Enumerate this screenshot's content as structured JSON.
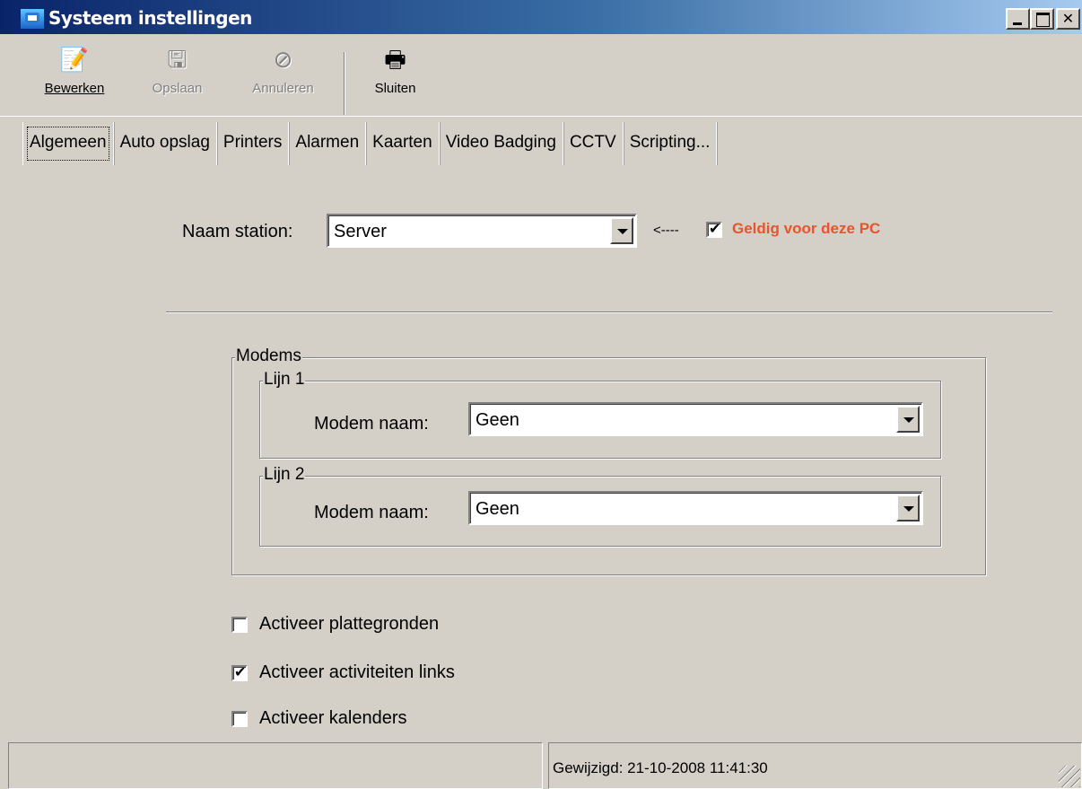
{
  "window": {
    "title": "Systeem instellingen",
    "minimize": "_",
    "maximize": "□",
    "close": "✕"
  },
  "toolbar": {
    "edit": {
      "label": "Bewerken",
      "icon": "edit-document-icon",
      "glyph": "📝"
    },
    "save": {
      "label": "Opslaan",
      "icon": "save-icon",
      "glyph": "🖫"
    },
    "cancel": {
      "label": "Annuleren",
      "icon": "cancel-icon",
      "glyph": "⊘"
    },
    "close": {
      "label": "Sluiten",
      "icon": "close-document-icon",
      "glyph": "🖶"
    }
  },
  "tabs": [
    "Algemeen",
    "Auto opslag",
    "Printers",
    "Alarmen",
    "Kaarten",
    "Video Badging",
    "CCTV",
    "Scripting..."
  ],
  "general": {
    "station_label": "Naam station:",
    "station_value": "Server",
    "arrow_text": "<----",
    "valid_label": "Geldig voor deze PC",
    "valid_checked": true,
    "valid_color": "#e8542c"
  },
  "modems": {
    "legend": "Modems",
    "line1": {
      "legend": "Lijn 1",
      "label": "Modem naam:",
      "value": "Geen"
    },
    "line2": {
      "legend": "Lijn 2",
      "label": "Modem naam:",
      "value": "Geen"
    }
  },
  "options": [
    {
      "label": "Activeer plattegronden",
      "checked": false
    },
    {
      "label": "Activeer activiteiten links",
      "checked": true
    },
    {
      "label": "Activeer kalenders",
      "checked": false
    }
  ],
  "status": {
    "left": "",
    "modified": "Gewijzigd: 21-10-2008 11:41:30"
  }
}
